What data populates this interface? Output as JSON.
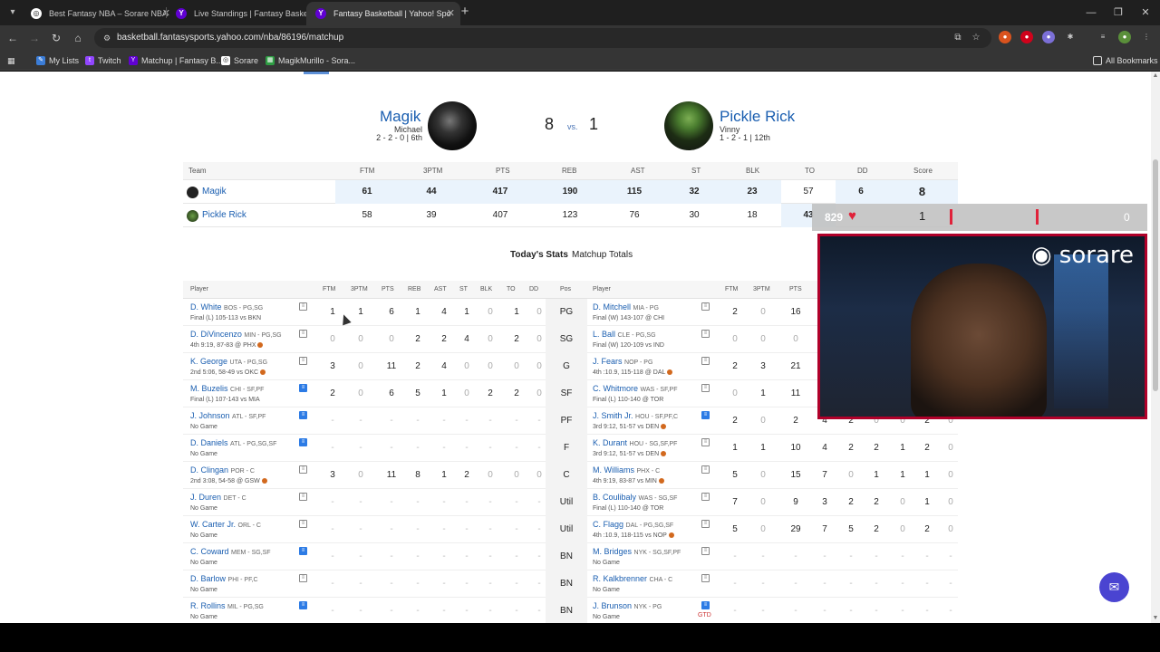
{
  "browser": {
    "tabs": [
      {
        "title": "Best Fantasy NBA – Sorare NBA",
        "icon": "sorare-icon"
      },
      {
        "title": "Live Standings | Fantasy Basketb",
        "icon": "yahoo-icon"
      },
      {
        "title": "Fantasy Basketball | Yahoo! Spo",
        "icon": "yahoo-icon"
      }
    ],
    "url": "basketball.fantasysports.yahoo.com/nba/86196/matchup",
    "bookmarks": [
      "My Lists",
      "Twitch",
      "Matchup | Fantasy B...",
      "Sorare",
      "MagikMurillo - Sora..."
    ],
    "all_bookmarks": "All Bookmarks"
  },
  "matchup": {
    "left": {
      "name": "Magik",
      "manager": "Michael",
      "record": "2 - 2 - 0 | 6th",
      "score": "8"
    },
    "vs": "vs.",
    "right": {
      "name": "Pickle Rick",
      "manager": "Vinny",
      "record": "1 - 2 - 1 | 12th",
      "score": "1"
    }
  },
  "summary": {
    "headers": [
      "Team",
      "FTM",
      "3PTM",
      "PTS",
      "REB",
      "AST",
      "ST",
      "BLK",
      "TO",
      "DD",
      "Score"
    ],
    "rows": [
      {
        "team": "Magik",
        "values": [
          "61",
          "44",
          "417",
          "190",
          "115",
          "32",
          "23",
          "57",
          "6",
          "8"
        ]
      },
      {
        "team": "Pickle Rick",
        "values": [
          "58",
          "39",
          "407",
          "123",
          "76",
          "30",
          "18",
          "43",
          "",
          ""
        ]
      }
    ]
  },
  "subtabs": [
    "Today's Stats",
    "Matchup Totals"
  ],
  "detail": {
    "left_headers": [
      "Player",
      "FTM",
      "3PTM",
      "PTS",
      "REB",
      "AST",
      "ST",
      "BLK",
      "TO",
      "DD"
    ],
    "pos_header": "Pos",
    "right_headers": [
      "Player",
      "FTM",
      "3PTM",
      "PTS"
    ],
    "rows": [
      {
        "pos": "PG",
        "l": {
          "name": "D. White",
          "team": "BOS - PG,SG",
          "game": "Final (L) 105-113 vs BKN",
          "dot": false,
          "note": "note",
          "stats": [
            "1",
            "1",
            "6",
            "1",
            "4",
            "1",
            "0",
            "1",
            "0"
          ]
        },
        "r": {
          "name": "D. Mitchell",
          "team": "MIA - PG",
          "game": "Final (W) 143-107 @ CHI",
          "dot": false,
          "note": "note",
          "stats": [
            "2",
            "0",
            "16",
            "",
            "",
            "",
            "",
            "",
            ""
          ]
        }
      },
      {
        "pos": "SG",
        "l": {
          "name": "D. DiVincenzo",
          "team": "MIN - PG,SG",
          "game": "4th 9:19, 87-83 @ PHX",
          "dot": true,
          "note": "note",
          "stats": [
            "0",
            "0",
            "0",
            "2",
            "2",
            "4",
            "0",
            "2",
            "0"
          ]
        },
        "r": {
          "name": "L. Ball",
          "team": "CLE - PG,SG",
          "game": "Final (W) 120-109 vs IND",
          "dot": false,
          "note": "note",
          "stats": [
            "0",
            "0",
            "0",
            "",
            "",
            "",
            "",
            "",
            ""
          ]
        }
      },
      {
        "pos": "G",
        "l": {
          "name": "K. George",
          "team": "UTA - PG,SG",
          "game": "2nd 5:06, 58-49 vs OKC",
          "dot": true,
          "note": "note",
          "stats": [
            "3",
            "0",
            "11",
            "2",
            "4",
            "0",
            "0",
            "0",
            "0"
          ]
        },
        "r": {
          "name": "J. Fears",
          "team": "NOP - PG",
          "game": "4th :10.9, 115-118 @ DAL",
          "dot": true,
          "note": "note",
          "stats": [
            "2",
            "3",
            "21",
            "",
            "",
            "",
            "",
            "",
            ""
          ]
        }
      },
      {
        "pos": "SF",
        "l": {
          "name": "M. Buzelis",
          "team": "CHI - SF,PF",
          "game": "Final (L) 107-143 vs MIA",
          "dot": false,
          "note": "blue",
          "stats": [
            "2",
            "0",
            "6",
            "5",
            "1",
            "0",
            "2",
            "2",
            "0"
          ]
        },
        "r": {
          "name": "C. Whitmore",
          "team": "WAS - SF,PF",
          "game": "Final (L) 110-140 @ TOR",
          "dot": false,
          "note": "note",
          "stats": [
            "0",
            "1",
            "11",
            "",
            "",
            "",
            "",
            "",
            ""
          ]
        }
      },
      {
        "pos": "PF",
        "l": {
          "name": "J. Johnson",
          "team": "ATL - SF,PF",
          "game": "No Game",
          "dot": false,
          "note": "blue",
          "stats": [
            "-",
            "-",
            "-",
            "-",
            "-",
            "-",
            "-",
            "-",
            "-"
          ]
        },
        "r": {
          "name": "J. Smith Jr.",
          "team": "HOU - SF,PF,C",
          "game": "3rd 9:12, 51-57 vs DEN",
          "dot": true,
          "note": "blue",
          "stats": [
            "2",
            "0",
            "2",
            "4",
            "2",
            "0",
            "0",
            "2",
            "0"
          ]
        }
      },
      {
        "pos": "F",
        "l": {
          "name": "D. Daniels",
          "team": "ATL - PG,SG,SF",
          "game": "No Game",
          "dot": false,
          "note": "blue",
          "stats": [
            "-",
            "-",
            "-",
            "-",
            "-",
            "-",
            "-",
            "-",
            "-"
          ]
        },
        "r": {
          "name": "K. Durant",
          "team": "HOU - SG,SF,PF",
          "game": "3rd 9:12, 51-57 vs DEN",
          "dot": true,
          "note": "note",
          "stats": [
            "1",
            "1",
            "10",
            "4",
            "2",
            "2",
            "1",
            "2",
            "0"
          ]
        }
      },
      {
        "pos": "C",
        "l": {
          "name": "D. Clingan",
          "team": "POR - C",
          "game": "2nd 3:08, 54-58 @ GSW",
          "dot": true,
          "note": "note",
          "stats": [
            "3",
            "0",
            "11",
            "8",
            "1",
            "2",
            "0",
            "0",
            "0"
          ]
        },
        "r": {
          "name": "M. Williams",
          "team": "PHX - C",
          "game": "4th 9:19, 83-87 vs MIN",
          "dot": true,
          "note": "note",
          "stats": [
            "5",
            "0",
            "15",
            "7",
            "0",
            "1",
            "1",
            "1",
            "0"
          ]
        }
      },
      {
        "pos": "Util",
        "l": {
          "name": "J. Duren",
          "team": "DET - C",
          "game": "No Game",
          "dot": false,
          "note": "note",
          "stats": [
            "-",
            "-",
            "-",
            "-",
            "-",
            "-",
            "-",
            "-",
            "-"
          ]
        },
        "r": {
          "name": "B. Coulibaly",
          "team": "WAS - SG,SF",
          "game": "Final (L) 110-140 @ TOR",
          "dot": false,
          "note": "note",
          "stats": [
            "7",
            "0",
            "9",
            "3",
            "2",
            "2",
            "0",
            "1",
            "0"
          ]
        }
      },
      {
        "pos": "Util",
        "l": {
          "name": "W. Carter Jr.",
          "team": "ORL - C",
          "game": "No Game",
          "dot": false,
          "note": "note",
          "stats": [
            "-",
            "-",
            "-",
            "-",
            "-",
            "-",
            "-",
            "-",
            "-"
          ]
        },
        "r": {
          "name": "C. Flagg",
          "team": "DAL - PG,SG,SF",
          "game": "4th :10.9, 118-115 vs NOP",
          "dot": true,
          "note": "note",
          "stats": [
            "5",
            "0",
            "29",
            "7",
            "5",
            "2",
            "0",
            "2",
            "0"
          ]
        }
      },
      {
        "pos": "BN",
        "l": {
          "name": "C. Coward",
          "team": "MEM - SG,SF",
          "game": "No Game",
          "dot": false,
          "note": "blue",
          "stats": [
            "-",
            "-",
            "-",
            "-",
            "-",
            "-",
            "-",
            "-",
            "-"
          ]
        },
        "r": {
          "name": "M. Bridges",
          "team": "NYK - SG,SF,PF",
          "game": "No Game",
          "dot": false,
          "note": "note",
          "stats": [
            "-",
            "-",
            "-",
            "-",
            "-",
            "-",
            "-",
            "-",
            "-"
          ]
        }
      },
      {
        "pos": "BN",
        "l": {
          "name": "D. Barlow",
          "team": "PHI - PF,C",
          "game": "No Game",
          "dot": false,
          "note": "note",
          "stats": [
            "-",
            "-",
            "-",
            "-",
            "-",
            "-",
            "-",
            "-",
            "-"
          ]
        },
        "r": {
          "name": "R. Kalkbrenner",
          "team": "CHA - C",
          "game": "No Game",
          "dot": false,
          "note": "note",
          "stats": [
            "-",
            "-",
            "-",
            "-",
            "-",
            "-",
            "-",
            "-",
            "-"
          ]
        }
      },
      {
        "pos": "BN",
        "l": {
          "name": "R. Rollins",
          "team": "MIL - PG,SG",
          "game": "No Game",
          "dot": false,
          "note": "blue",
          "stats": [
            "-",
            "-",
            "-",
            "-",
            "-",
            "-",
            "-",
            "-",
            "-"
          ]
        },
        "r": {
          "name": "J. Brunson",
          "team": "NYK - PG",
          "game": "No Game",
          "dot": false,
          "note": "blue",
          "gtd": "GTD",
          "stats": [
            "-",
            "-",
            "-",
            "-",
            "-",
            "-",
            "-",
            "-",
            "-"
          ]
        }
      }
    ]
  },
  "overlay": {
    "count": "829",
    "score": "1",
    "right_score": "0",
    "webcam_logo": "sorare"
  },
  "colors": {
    "link": "#1a5eb0",
    "highlight": "#eaf3fc",
    "accent": "#e0223a"
  }
}
